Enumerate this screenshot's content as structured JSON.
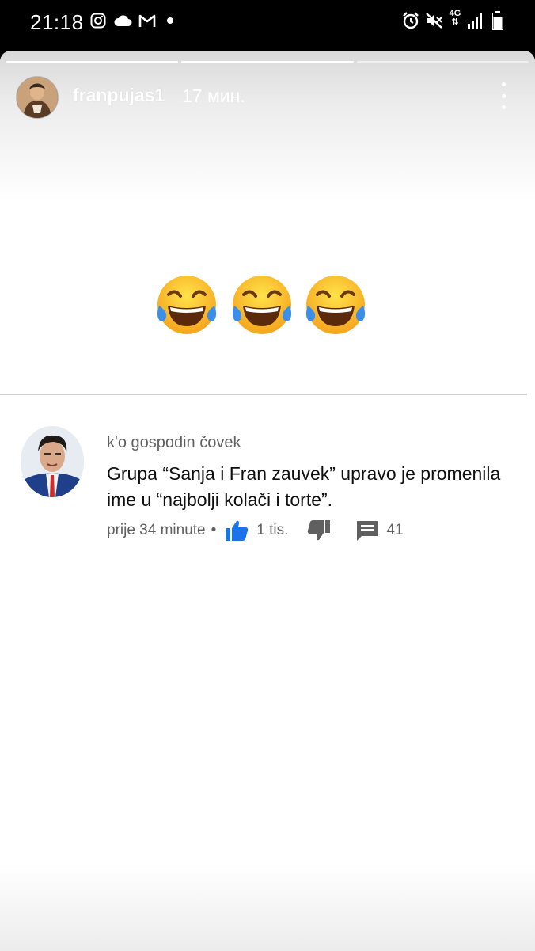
{
  "status_bar": {
    "time": "21:18",
    "left_icons": [
      "instagram-icon",
      "cloud-icon",
      "gmail-icon",
      "dot-icon"
    ],
    "right_icons": [
      "alarm-icon",
      "mute-icon",
      "network-4g-icon",
      "signal-icon",
      "battery-icon"
    ],
    "network_label": "4G"
  },
  "story": {
    "progress_segments": [
      1.0,
      1.0,
      0.0
    ],
    "username": "franpujas1",
    "time_ago": "17 мин.",
    "emojis": [
      "face-with-tears-of-joy-icon",
      "face-with-tears-of-joy-icon",
      "face-with-tears-of-joy-icon"
    ]
  },
  "comment": {
    "author": "k'o gospodin čovek",
    "text": "Grupa “Sanja i Fran zauvek” upravo je promenila ime u “najbolji kolači i torte”.",
    "time": "prije 34 minute",
    "separator": "•",
    "likes": "1 tis.",
    "replies": "41",
    "like_color": "#1a73e8"
  },
  "colors": {
    "story_background": "#ffffff",
    "status_bar_background": "#000000",
    "divider": "#cfcfcf",
    "secondary_text": "#606060"
  }
}
